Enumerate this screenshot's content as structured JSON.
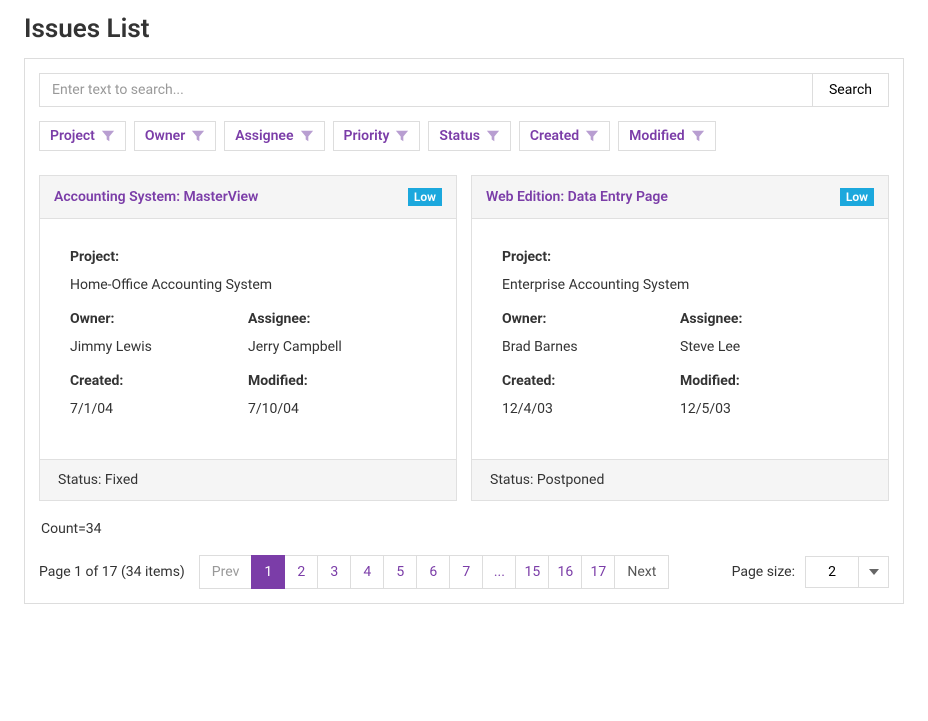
{
  "page_title": "Issues List",
  "search": {
    "placeholder": "Enter text to search...",
    "button": "Search"
  },
  "filter_chips": [
    "Project",
    "Owner",
    "Assignee",
    "Priority",
    "Status",
    "Created",
    "Modified"
  ],
  "labels": {
    "project": "Project:",
    "owner": "Owner:",
    "assignee": "Assignee:",
    "created": "Created:",
    "modified": "Modified:",
    "status_prefix": "Status: "
  },
  "cards": [
    {
      "title": "Accounting System: MasterView",
      "priority": "Low",
      "project": "Home-Office Accounting System",
      "owner": "Jimmy Lewis",
      "assignee": "Jerry Campbell",
      "created": "7/1/04",
      "modified": "7/10/04",
      "status": "Fixed"
    },
    {
      "title": "Web Edition: Data Entry Page",
      "priority": "Low",
      "project": "Enterprise Accounting System",
      "owner": "Brad Barnes",
      "assignee": "Steve Lee",
      "created": "12/4/03",
      "modified": "12/5/03",
      "status": "Postponed"
    }
  ],
  "count_line": "Count=34",
  "pager": {
    "info": "Page 1 of 17 (34 items)",
    "prev": "Prev",
    "next": "Next",
    "pages_head": [
      "1",
      "2",
      "3",
      "4",
      "5",
      "6",
      "7"
    ],
    "ellipsis": "...",
    "pages_tail": [
      "15",
      "16",
      "17"
    ],
    "active": "1",
    "page_size_label": "Page size:",
    "page_size_value": "2"
  },
  "colors": {
    "accent": "#7b3da8",
    "badge": "#1ca8dd"
  }
}
